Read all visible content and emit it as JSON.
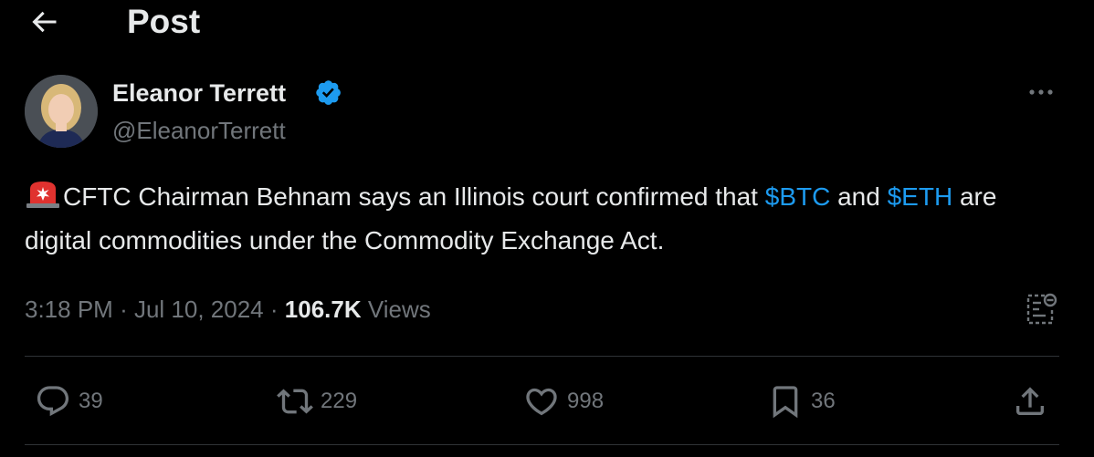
{
  "header": {
    "title": "Post"
  },
  "author": {
    "name": "Eleanor Terrett",
    "handle": "@EleanorTerrett",
    "verified": true
  },
  "tweet": {
    "text_part1": "CFTC Chairman Behnam says an Illinois court confirmed that ",
    "cashtag1": "$BTC",
    "text_part2": " and ",
    "cashtag2": "$ETH",
    "text_part3": " are digital commodities under the Commodity Exchange Act.",
    "emoji": "rotating-light"
  },
  "meta": {
    "time": "3:18 PM",
    "separator": "·",
    "date": "Jul 10, 2024",
    "views_count": "106.7K",
    "views_label": "Views"
  },
  "actions": {
    "replies": "39",
    "reposts": "229",
    "likes": "998",
    "bookmarks": "36"
  },
  "colors": {
    "background": "#000000",
    "text": "#e7e9ea",
    "muted": "#71767b",
    "accent": "#1d9bf0",
    "divider": "#2f3336"
  }
}
